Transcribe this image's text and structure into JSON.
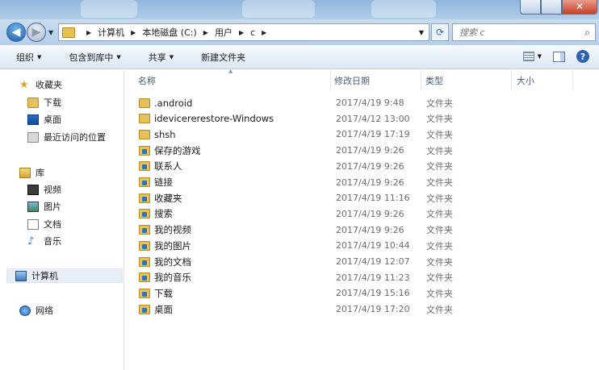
{
  "window": {
    "controls": [
      "minimize",
      "maximize",
      "close"
    ]
  },
  "address": {
    "crumbs": [
      "计算机",
      "本地磁盘 (C:)",
      "用户",
      "c"
    ]
  },
  "search": {
    "placeholder": "搜索 c"
  },
  "toolbar": {
    "organize": "组织",
    "include_library": "包含到库中",
    "share": "共享",
    "new_folder": "新建文件夹"
  },
  "nav": {
    "favorites": "收藏夹",
    "downloads": "下载",
    "desktop": "桌面",
    "recent": "最近访问的位置",
    "libraries": "库",
    "videos": "视频",
    "pictures": "图片",
    "documents": "文档",
    "music": "音乐",
    "computer": "计算机",
    "network": "网络"
  },
  "columns": {
    "name": "名称",
    "date": "修改日期",
    "type": "类型",
    "size": "大小"
  },
  "files": [
    {
      "name": ".android",
      "date": "2017/4/19 9:48",
      "type": "文件夹",
      "icon": "folder-icon"
    },
    {
      "name": "idevicererestore-Windows",
      "date": "2017/4/12 13:00",
      "type": "文件夹",
      "icon": "folder-icon"
    },
    {
      "name": "shsh",
      "date": "2017/4/19 17:19",
      "type": "文件夹",
      "icon": "folder-icon"
    },
    {
      "name": "保存的游戏",
      "date": "2017/4/19 9:26",
      "type": "文件夹",
      "icon": "saved-games-folder-icon"
    },
    {
      "name": "联系人",
      "date": "2017/4/19 9:26",
      "type": "文件夹",
      "icon": "contacts-folder-icon"
    },
    {
      "name": "链接",
      "date": "2017/4/19 9:26",
      "type": "文件夹",
      "icon": "links-folder-icon"
    },
    {
      "name": "收藏夹",
      "date": "2017/4/19 11:16",
      "type": "文件夹",
      "icon": "favorites-folder-icon"
    },
    {
      "name": "搜索",
      "date": "2017/4/19 9:26",
      "type": "文件夹",
      "icon": "searches-folder-icon"
    },
    {
      "name": "我的视频",
      "date": "2017/4/19 9:26",
      "type": "文件夹",
      "icon": "videos-folder-icon"
    },
    {
      "name": "我的图片",
      "date": "2017/4/19 10:44",
      "type": "文件夹",
      "icon": "pictures-folder-icon"
    },
    {
      "name": "我的文档",
      "date": "2017/4/19 12:07",
      "type": "文件夹",
      "icon": "documents-folder-icon"
    },
    {
      "name": "我的音乐",
      "date": "2017/4/19 11:23",
      "type": "文件夹",
      "icon": "music-folder-icon"
    },
    {
      "name": "下载",
      "date": "2017/4/19 15:16",
      "type": "文件夹",
      "icon": "downloads-folder-icon"
    },
    {
      "name": "桌面",
      "date": "2017/4/19 17:20",
      "type": "文件夹",
      "icon": "desktop-folder-icon"
    }
  ]
}
